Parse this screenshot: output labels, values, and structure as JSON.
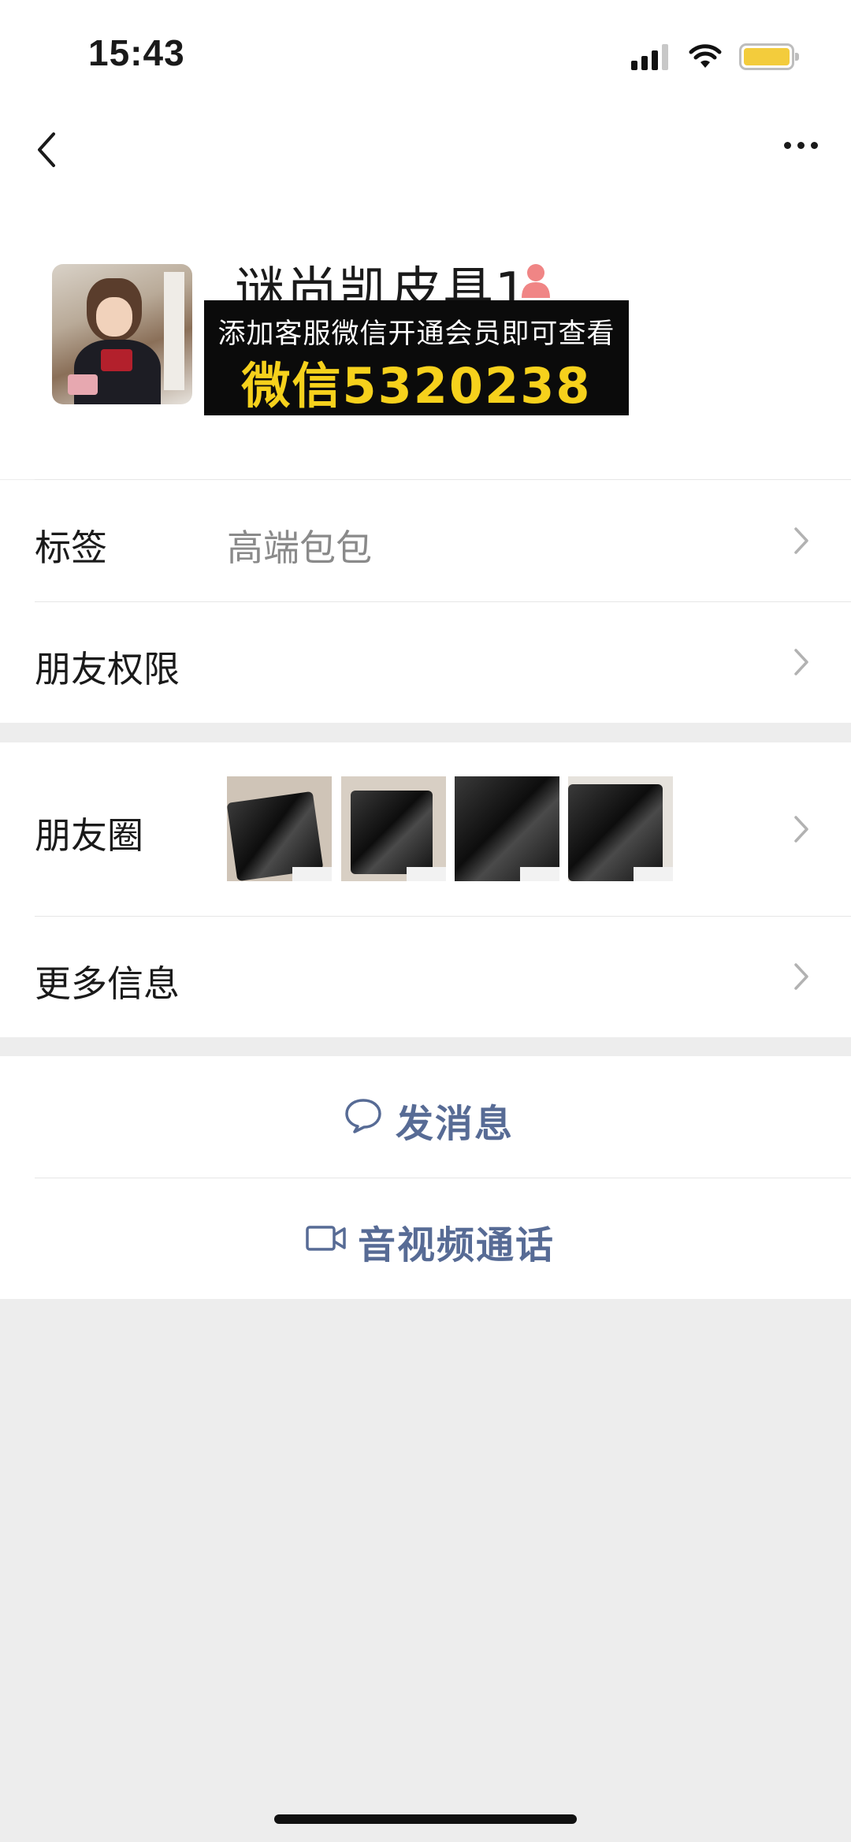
{
  "status_bar": {
    "time": "15:43"
  },
  "profile": {
    "name": "谜尚凯皮具1",
    "promo_line1": "添加客服微信开通会员即可查看",
    "promo_line2": "微信5320238"
  },
  "rows": {
    "tags_label": "标签",
    "tags_value": "高端包包",
    "permissions_label": "朋友权限",
    "moments_label": "朋友圈",
    "more_info_label": "更多信息"
  },
  "actions": {
    "send_message": "发消息",
    "av_call": "音视频通话"
  },
  "colors": {
    "link": "#576b95",
    "promo_text": "#f6d11c",
    "background": "#ededed",
    "battery": "#f3cc3c"
  },
  "icons": [
    "chevron-left-icon",
    "more-dots-icon",
    "person-icon",
    "chevron-right-icon",
    "chat-bubble-icon",
    "video-camera-icon"
  ]
}
